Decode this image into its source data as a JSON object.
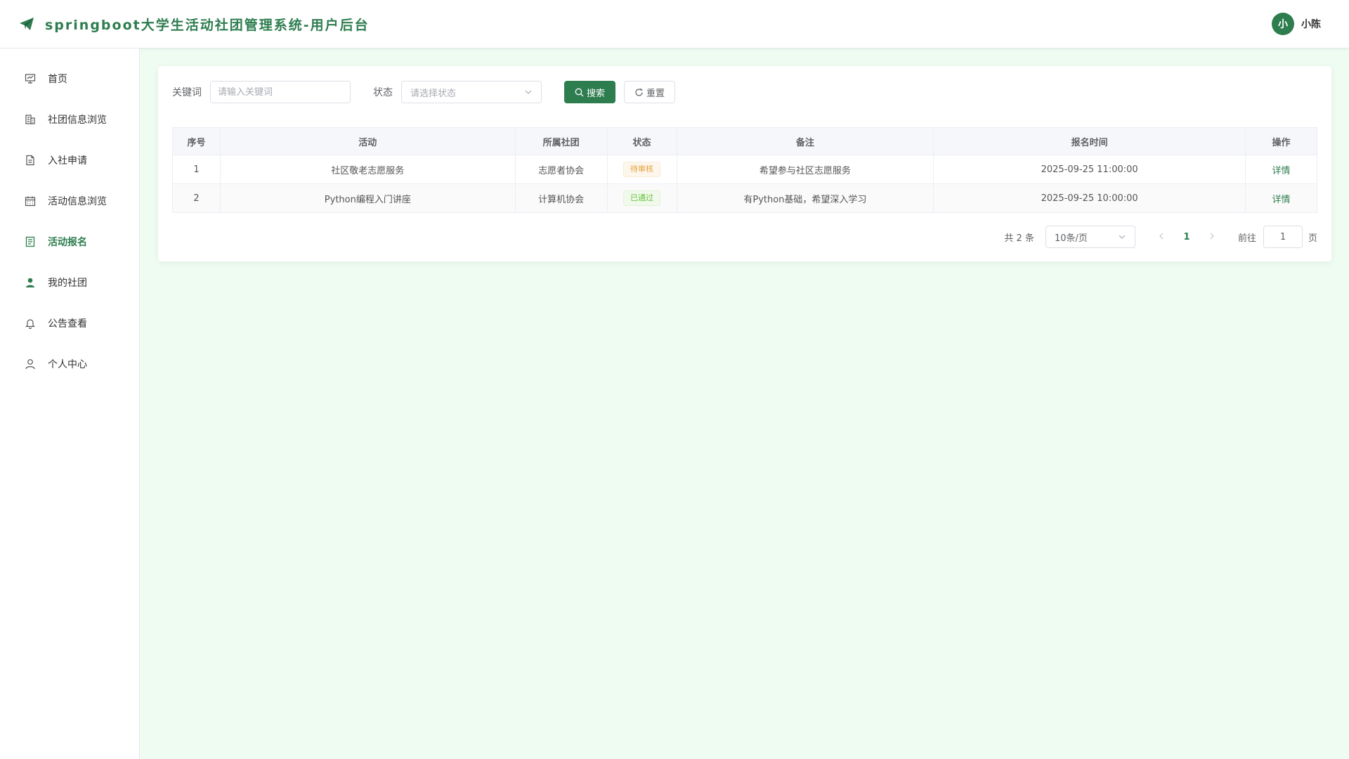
{
  "header": {
    "title": "springboot大学生活动社团管理系统-用户后台",
    "user_avatar": "小",
    "user_name": "小陈"
  },
  "sidebar": {
    "items": [
      {
        "label": "首页",
        "icon": "presentation-chart-icon"
      },
      {
        "label": "社团信息浏览",
        "icon": "building-icon"
      },
      {
        "label": "入社申请",
        "icon": "document-icon"
      },
      {
        "label": "活动信息浏览",
        "icon": "calendar-icon"
      },
      {
        "label": "活动报名",
        "icon": "list-document-icon",
        "active": true
      },
      {
        "label": "我的社团",
        "icon": "user-filled-icon"
      },
      {
        "label": "公告查看",
        "icon": "bell-icon"
      },
      {
        "label": "个人中心",
        "icon": "user-icon"
      }
    ]
  },
  "search": {
    "keyword_label": "关键词",
    "keyword_placeholder": "请输入关键词",
    "status_label": "状态",
    "status_placeholder": "请选择状态",
    "search_button": "搜索",
    "reset_button": "重置"
  },
  "table": {
    "columns": [
      "序号",
      "活动",
      "所属社团",
      "状态",
      "备注",
      "报名时间",
      "操作"
    ],
    "rows": [
      {
        "index": "1",
        "activity": "社区敬老志愿服务",
        "club": "志愿者协会",
        "status": "待审核",
        "remark": "希望参与社区志愿服务",
        "time": "2025-09-25 11:00:00",
        "action": "详情"
      },
      {
        "index": "2",
        "activity": "Python编程入门讲座",
        "club": "计算机协会",
        "status": "已通过",
        "remark": "有Python基础，希望深入学习",
        "time": "2025-09-25 10:00:00",
        "action": "详情"
      }
    ]
  },
  "pagination": {
    "total_text": "共 2 条",
    "page_size": "10条/页",
    "current_page": "1",
    "goto_label": "前往",
    "goto_value": "1",
    "page_suffix": "页"
  },
  "colors": {
    "accent": "#2e7d4f",
    "background": "#eefcf2",
    "tag_pending": "#e6a23c",
    "tag_approved": "#67c23a"
  }
}
